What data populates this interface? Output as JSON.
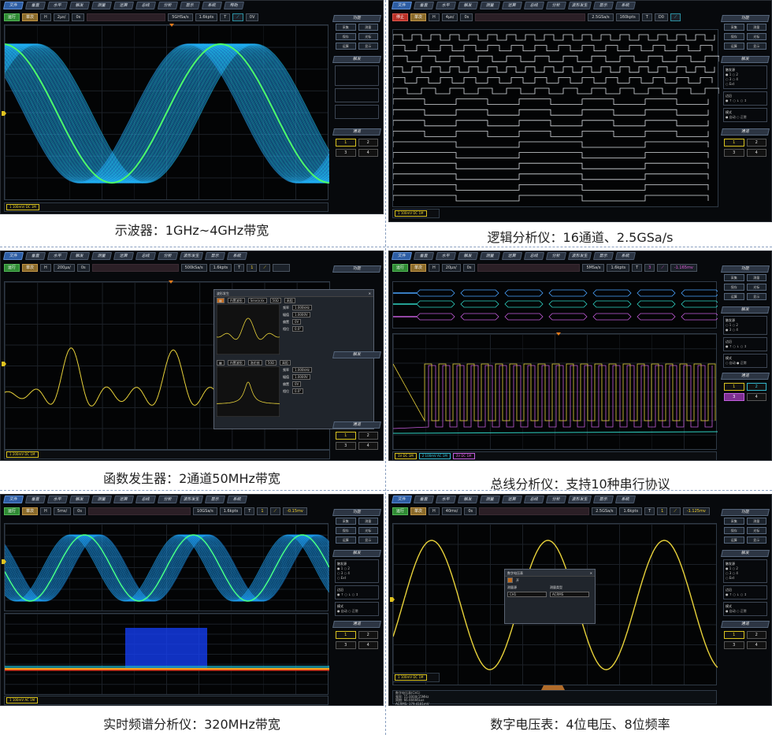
{
  "captions": {
    "p1": "示波器：1GHz~4GHz带宽",
    "p2": "逻辑分析仪：16通道、2.5GSa/s",
    "p3": "函数发生器：2通道50MHz带宽",
    "p4": "总线分析仪：支持10种串行协议",
    "p5": "实时频谱分析仪：320MHz带宽",
    "p6": "数字电压表：4位电压、8位频率"
  },
  "menu": [
    "文件",
    "垂直",
    "水平",
    "触发",
    "测量",
    "运算",
    "总线",
    "分析",
    "波形发生",
    "显示",
    "系统"
  ],
  "p1": {
    "menu": [
      "文件",
      "垂直",
      "水平",
      "触发",
      "测量",
      "运算",
      "总线",
      "分析",
      "显示",
      "系统",
      "帮助"
    ],
    "run": "运行",
    "mode": "单次",
    "h": "H",
    "timebase": "2μs/",
    "offset": "0s",
    "sample": "5GHSa/s",
    "pts": "1.6kpts",
    "t": "T",
    "level": "0V",
    "side": {
      "func": "功能",
      "b1": "采集",
      "b2": "测量",
      "b3": "保存",
      "b4": "光标",
      "b5": "运算",
      "b6": "显示",
      "trig": "触发",
      "channel": "通道"
    },
    "status": "1 100mV/ DC 1M"
  },
  "p2": {
    "run": "停止",
    "mode": "单次",
    "h": "H",
    "timebase": "4μs/",
    "offset": "0s",
    "sample": "2.5GSa/s",
    "pts": "160kpts",
    "t": "T",
    "src": "D0",
    "side": {
      "func": "功能",
      "b1": "采集",
      "b2": "测量",
      "b3": "保存",
      "b4": "光标",
      "b5": "运算",
      "b6": "显示",
      "trig": "触发",
      "src_label": "触发源",
      "edge": "边沿",
      "mode": "模式",
      "auto": "自动",
      "normal": "正常",
      "channel": "通道"
    },
    "status": "1 100mV DC 1M",
    "ch": [
      "1",
      "2",
      "3",
      "4"
    ]
  },
  "p3": {
    "run": "运行",
    "mode": "单次",
    "h": "H",
    "timebase": "200μs/",
    "offset": "0s",
    "sample": "500kSa/s",
    "pts": "1.6kpts",
    "t": "T",
    "level": "1",
    "side": {
      "func": "功能",
      "trig": "触发",
      "channel": "通道"
    },
    "dialog": {
      "title": "波形发生",
      "wave": "内置波形",
      "fn1": "Sinx(x)/x",
      "fn2": "洛伦兹",
      "out": "50Ω",
      "on": "高阻",
      "rows": [
        "频率",
        "幅值",
        "偏置",
        "相位"
      ],
      "vals1": [
        "1.000kHz",
        "1.0000V",
        "0V",
        "0.0°"
      ],
      "vals2": [
        "1.000kHz",
        "1.0000V",
        "0V",
        "0.0°"
      ],
      "tabs": [
        "频率",
        "周期",
        "幅值/偏置",
        "最值"
      ]
    },
    "status": "1 200mV DC 1M"
  },
  "p4": {
    "run": "运行",
    "mode": "单次",
    "h": "H",
    "timebase": "20μs/",
    "offset": "0s",
    "sample": "5MSa/s",
    "pts": "1.6kpts",
    "t": "T",
    "level": "-1.165mv",
    "side": {
      "func": "功能",
      "b1": "采集",
      "b2": "测量",
      "b3": "保存",
      "b4": "光标",
      "b5": "运算",
      "b6": "显示",
      "trig": "触发",
      "src_label": "触发源",
      "edge": "边沿",
      "mode": "模式",
      "auto": "自动",
      "normal": "正常",
      "channel": "通道"
    },
    "status": [
      "1V DC 1M",
      "2 100mV AC 1M",
      "3V DC 1M"
    ]
  },
  "p5": {
    "run": "运行",
    "mode": "单次",
    "h": "H",
    "timebase": "5ms/",
    "offset": "0s",
    "sample": "10GSa/s",
    "pts": "1.6kpts",
    "t": "T",
    "level": "-0.15mv",
    "side": {
      "func": "功能",
      "b1": "采集",
      "b2": "测量",
      "b3": "保存",
      "b4": "光标",
      "b5": "运算",
      "b6": "显示",
      "trig": "触发",
      "src_label": "触发源",
      "edge": "边沿",
      "mode": "模式",
      "auto": "自动",
      "normal": "正常",
      "channel": "通道"
    },
    "status": "1 100mV AC 1M"
  },
  "p6": {
    "run": "运行",
    "mode": "单次",
    "h": "H",
    "timebase": "40ms/",
    "offset": "0s",
    "sample": "2.5GSa/s",
    "pts": "1.6kpts",
    "t": "T",
    "level": "-1.125mv",
    "side": {
      "func": "功能",
      "b1": "采集",
      "b2": "测量",
      "b3": "保存",
      "b4": "光标",
      "b5": "运算",
      "b6": "显示",
      "trig": "触发",
      "src_label": "触发源",
      "edge": "边沿",
      "mode": "模式",
      "auto": "自动",
      "normal": "正常",
      "channel": "通道"
    },
    "dialog": {
      "title": "数字电压表",
      "on": "开",
      "src_label": "测量源",
      "type_label": "测量类型",
      "src": "CH1",
      "type": "ACRMS"
    },
    "readout": [
      "数字电压表(CH1)",
      "频率: 15.0000(15MHz",
      "周期: 66.66666Lus",
      "ACRMS: 179.4181mV"
    ],
    "status": "1 100mV DC 1M"
  }
}
